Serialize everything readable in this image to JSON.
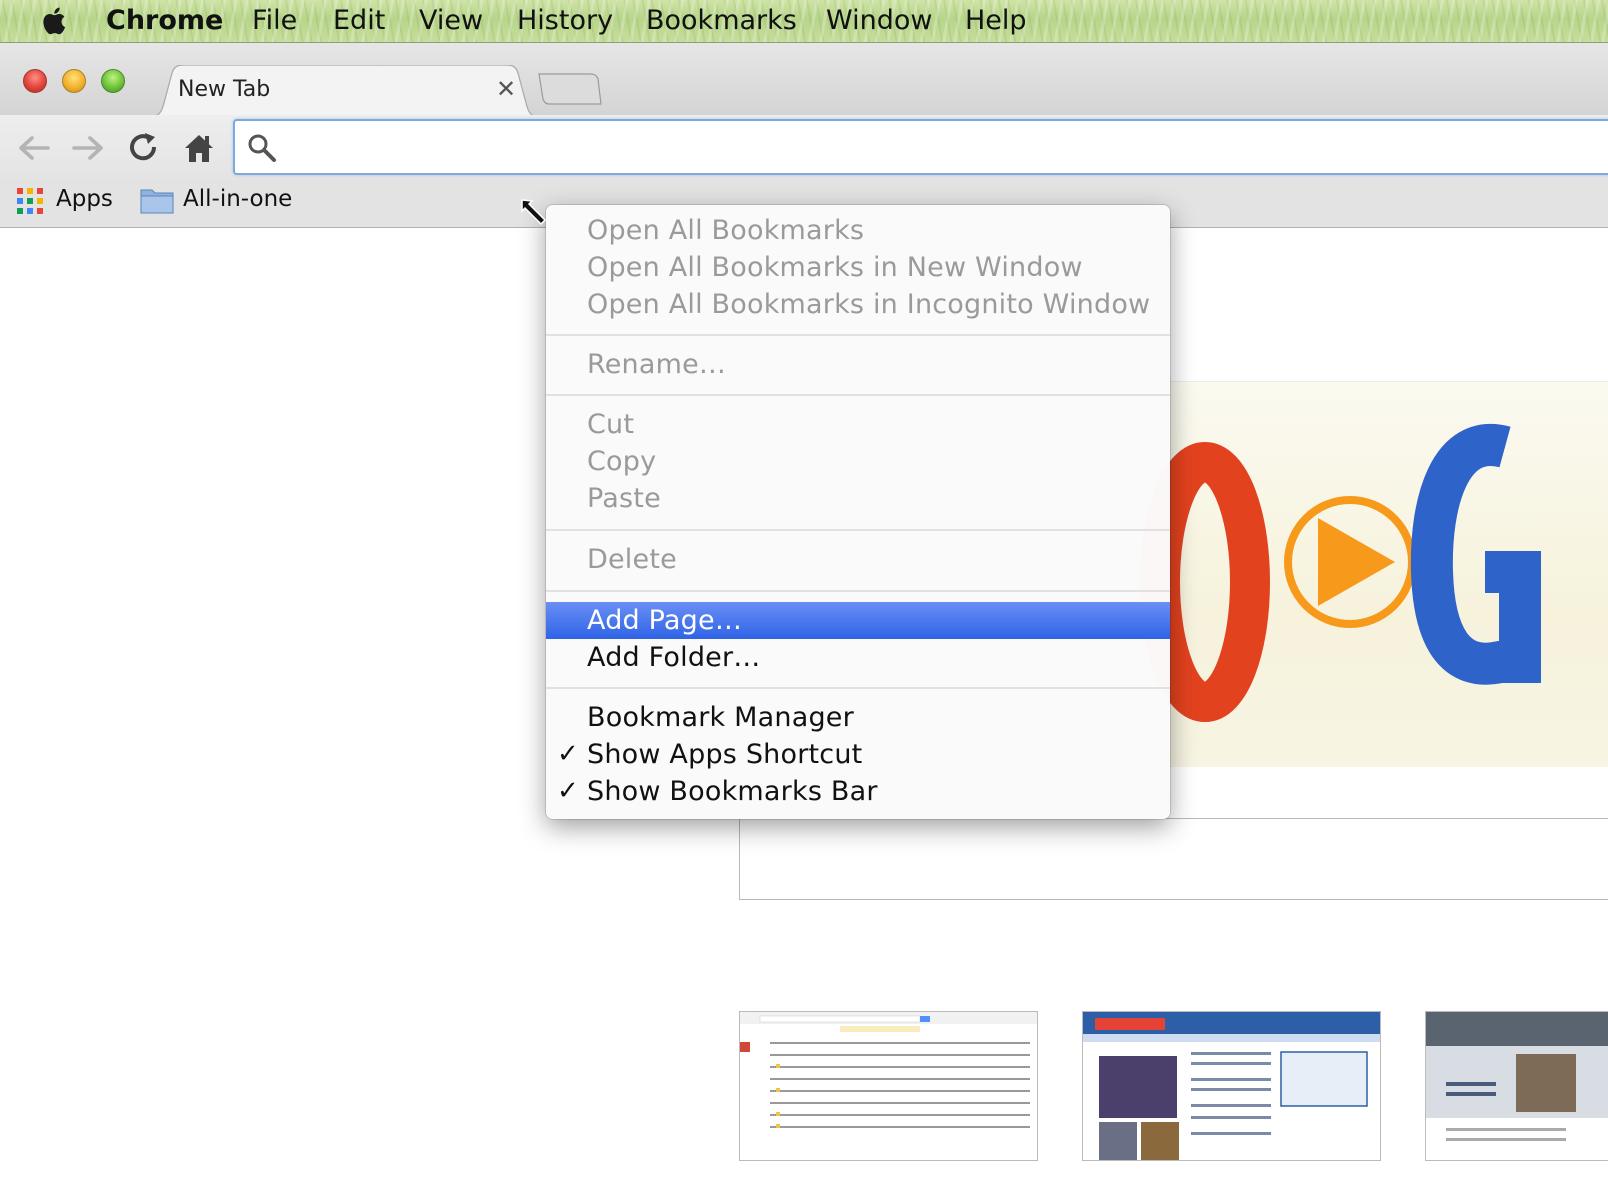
{
  "menubar": {
    "app_name": "Chrome",
    "items": [
      "File",
      "Edit",
      "View",
      "History",
      "Bookmarks",
      "Window",
      "Help"
    ]
  },
  "tab": {
    "title": "New Tab",
    "close_glyph": "✕"
  },
  "bookmarks_bar": {
    "apps_label": "Apps",
    "folder_label": "All-in-one"
  },
  "context_menu": {
    "open_all": "Open All Bookmarks",
    "open_all_new_window": "Open All Bookmarks in New Window",
    "open_all_incognito": "Open All Bookmarks in Incognito Window",
    "rename": "Rename…",
    "cut": "Cut",
    "copy": "Copy",
    "paste": "Paste",
    "delete": "Delete",
    "add_page": "Add Page…",
    "add_folder": "Add Folder…",
    "bookmark_manager": "Bookmark Manager",
    "show_apps_shortcut": "Show Apps Shortcut",
    "show_bookmarks_bar": "Show Bookmarks Bar",
    "check_glyph": "✓"
  },
  "colors": {
    "menu_highlight": "#3d6fea",
    "disabled_text": "#9a9a9a",
    "omnibox_focus": "#7ea9dd",
    "google_red": "#e3421f",
    "google_blue": "#2e63c9",
    "play_orange": "#f79a1c"
  }
}
